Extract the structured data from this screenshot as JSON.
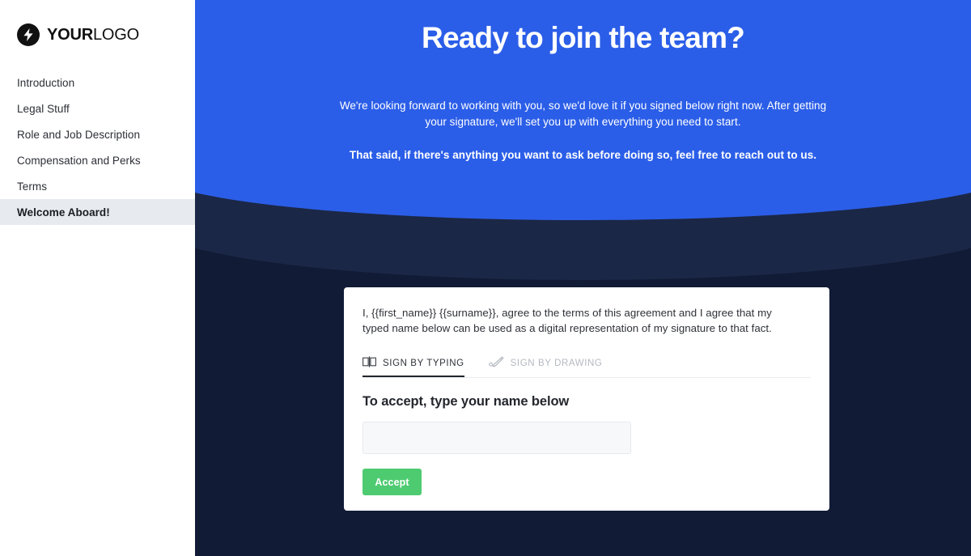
{
  "brand": {
    "logo_icon": "lightning-bolt-icon",
    "name_bold": "YOUR",
    "name_light": "LOGO"
  },
  "sidebar": {
    "items": [
      {
        "label": "Introduction",
        "active": false
      },
      {
        "label": "Legal Stuff",
        "active": false
      },
      {
        "label": "Role and Job Description",
        "active": false
      },
      {
        "label": "Compensation and Perks",
        "active": false
      },
      {
        "label": "Terms",
        "active": false
      },
      {
        "label": "Welcome Aboard!",
        "active": true
      }
    ]
  },
  "hero": {
    "title": "Ready to join the team?",
    "body": "We're looking forward to working with you, so we'd love it if you signed below right now. After getting your signature, we'll set you up with everything you need to start.",
    "body_strong": "That said, if there's anything you want to ask before doing so, feel free to reach out to us."
  },
  "card": {
    "consent_text": "I, {{first_name}} {{surname}}, agree to the terms of this agreement and I agree that my typed name below can be used as a digital representation of my signature to that fact.",
    "tabs": [
      {
        "label": "SIGN BY TYPING",
        "icon": "keyboard-icon",
        "active": true
      },
      {
        "label": "SIGN BY DRAWING",
        "icon": "pen-signature-icon",
        "active": false
      }
    ],
    "accept_heading": "To accept, type your name below",
    "name_input_value": "",
    "name_input_placeholder": "",
    "accept_button_label": "Accept"
  },
  "colors": {
    "hero_blue": "#2b5ee8",
    "navy": "#111b36",
    "navy_accent": "#1b2746",
    "accept_green": "#4ecb71",
    "sidebar_active_bg": "#e7eaee"
  }
}
